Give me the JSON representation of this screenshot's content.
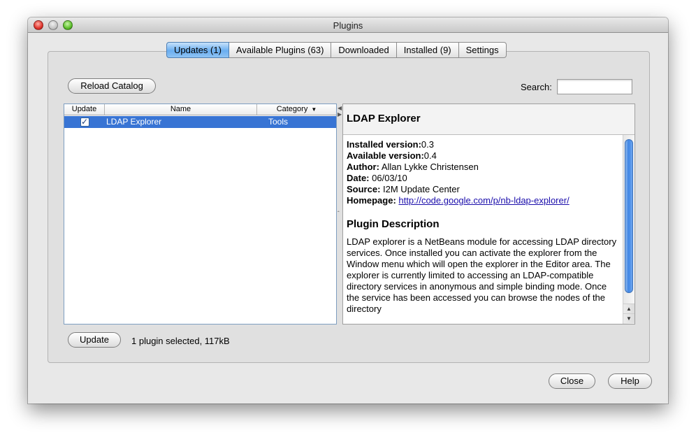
{
  "window": {
    "title": "Plugins"
  },
  "tabs": [
    {
      "label": "Updates (1)",
      "active": true
    },
    {
      "label": "Available Plugins (63)",
      "active": false
    },
    {
      "label": "Downloaded",
      "active": false
    },
    {
      "label": "Installed (9)",
      "active": false
    },
    {
      "label": "Settings",
      "active": false
    }
  ],
  "toolbar": {
    "reload_label": "Reload Catalog"
  },
  "search": {
    "label": "Search:",
    "value": ""
  },
  "table": {
    "headers": {
      "update": "Update",
      "name": "Name",
      "category": "Category"
    },
    "sort_indicator_icon": "sort-descending-icon",
    "rows": [
      {
        "checked": true,
        "name": "LDAP Explorer",
        "category": "Tools",
        "selected": true
      }
    ]
  },
  "details": {
    "title": "LDAP Explorer",
    "fields": [
      {
        "label": "Installed version:",
        "value": "0.3"
      },
      {
        "label": "Available version:",
        "value": "0.4"
      },
      {
        "label": "Author:",
        "value": " Allan Lykke Christensen"
      },
      {
        "label": "Date:",
        "value": " 06/03/10"
      },
      {
        "label": "Source:",
        "value": " I2M Update Center"
      }
    ],
    "homepage_label": "Homepage:",
    "homepage_url": "http://code.google.com/p/nb-ldap-explorer/",
    "description_heading": "Plugin Description",
    "description": "LDAP explorer is a NetBeans module for accessing LDAP directory services. Once installed you can activate the explorer from the Window menu which will open the explorer in the Editor area. The explorer is currently limited to accessing an LDAP-compatible directory services in anonymous and simple binding mode. Once the service has been accessed you can browse the nodes of the directory"
  },
  "footer": {
    "update_label": "Update",
    "status": "1 plugin selected, 117kB"
  },
  "dialog_buttons": {
    "close_label": "Close",
    "help_label": "Help"
  },
  "colors": {
    "selection": "#3874d4",
    "active_tab": "#6aaef0",
    "link": "#1a0dab"
  }
}
